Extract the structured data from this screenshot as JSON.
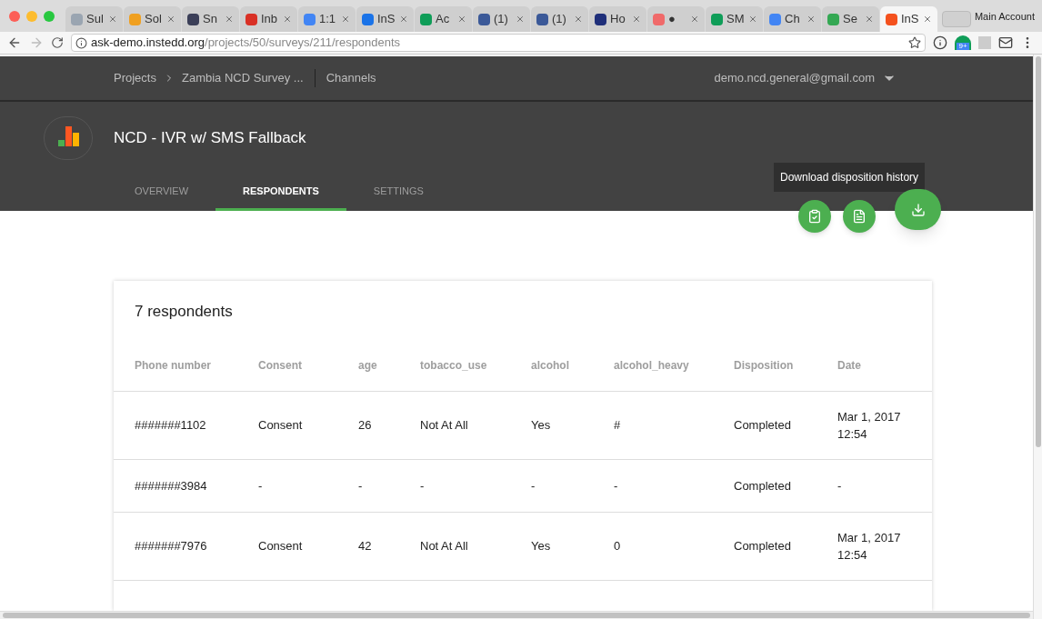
{
  "browser": {
    "tabs": [
      {
        "title": "Sul",
        "color": "#9aa5b1",
        "selected": false
      },
      {
        "title": "Sol",
        "color": "#f0a020",
        "selected": false
      },
      {
        "title": "Sn",
        "color": "#3b3f58",
        "selected": false
      },
      {
        "title": "Inb",
        "color": "#d93025",
        "selected": false
      },
      {
        "title": "1:1",
        "color": "#4285f4",
        "selected": false
      },
      {
        "title": "InS",
        "color": "#1a73e8",
        "selected": false
      },
      {
        "title": "Ac",
        "color": "#0f9d58",
        "selected": false
      },
      {
        "title": "(1)",
        "color": "#3b5998",
        "selected": false
      },
      {
        "title": "(1)",
        "color": "#3b5998",
        "selected": false
      },
      {
        "title": "Ho",
        "color": "#1f2f7a",
        "selected": false
      },
      {
        "title": "●",
        "color": "#f06a6a",
        "selected": false
      },
      {
        "title": "SM",
        "color": "#0f9d58",
        "selected": false
      },
      {
        "title": "Ch",
        "color": "#4285f4",
        "selected": false
      },
      {
        "title": "Se",
        "color": "#34a853",
        "selected": false
      },
      {
        "title": "InS",
        "color": "#f4511e",
        "selected": true
      }
    ],
    "profile": "Main Account",
    "url_host": "ask-demo.instedd.org",
    "url_path": "/projects/50/surveys/211/respondents",
    "extension_badge": "9+"
  },
  "nav": {
    "breadcrumbs": [
      "Projects",
      "Zambia NCD Survey ..."
    ],
    "channels": "Channels",
    "user": "demo.ncd.general@gmail.com"
  },
  "survey": {
    "title": "NCD - IVR w/ SMS Fallback",
    "tabs": [
      {
        "label": "OVERVIEW",
        "selected": false
      },
      {
        "label": "RESPONDENTS",
        "selected": true
      },
      {
        "label": "SETTINGS",
        "selected": false
      }
    ],
    "tooltip": "Download disposition history"
  },
  "table": {
    "title": "7 respondents",
    "columns": [
      "Phone number",
      "Consent",
      "age",
      "tobacco_use",
      "alcohol",
      "alcohol_heavy",
      "Disposition",
      "Date"
    ],
    "rows": [
      [
        "#######1102",
        "Consent",
        "26",
        "Not At All",
        "Yes",
        "#",
        "Completed",
        "Mar 1, 2017\n12:54"
      ],
      [
        "#######3984",
        "-",
        "-",
        "-",
        "-",
        "-",
        "Completed",
        "-"
      ],
      [
        "#######7976",
        "Consent",
        "42",
        "Not At All",
        "Yes",
        "0",
        "Completed",
        "Mar 1, 2017\n12:54"
      ]
    ]
  }
}
